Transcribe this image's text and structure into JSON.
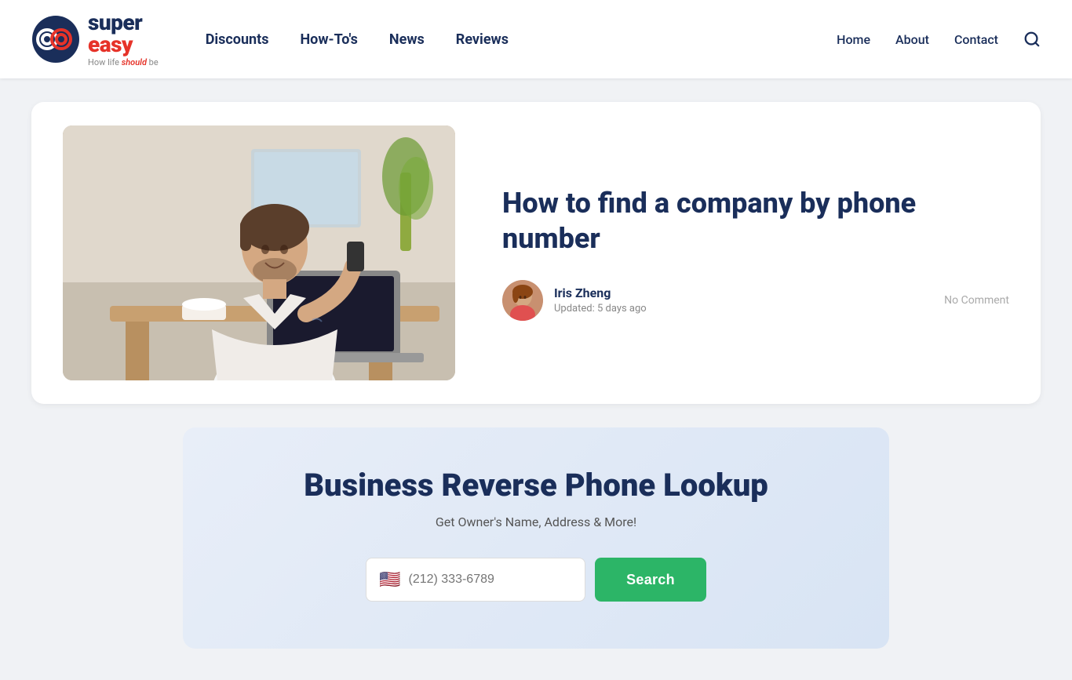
{
  "header": {
    "logo": {
      "brand": "super easy",
      "tagline_prefix": "How life ",
      "tagline_italic": "should",
      "tagline_suffix": " be"
    },
    "nav": {
      "items": [
        {
          "label": "Discounts",
          "href": "#"
        },
        {
          "label": "How-To's",
          "href": "#"
        },
        {
          "label": "News",
          "href": "#"
        },
        {
          "label": "Reviews",
          "href": "#"
        }
      ]
    },
    "right_nav": {
      "items": [
        {
          "label": "Home",
          "href": "#"
        },
        {
          "label": "About",
          "href": "#"
        },
        {
          "label": "Contact",
          "href": "#"
        }
      ]
    }
  },
  "article": {
    "title": "How to find a company by phone number",
    "author": {
      "name": "Iris Zheng",
      "updated": "Updated: 5 days ago"
    },
    "no_comment": "No Comment"
  },
  "lookup_widget": {
    "title": "Business Reverse Phone Lookup",
    "subtitle": "Get Owner's Name, Address & More!",
    "input_placeholder": "(212) 333-6789",
    "search_label": "Search",
    "flag": "🇺🇸"
  }
}
